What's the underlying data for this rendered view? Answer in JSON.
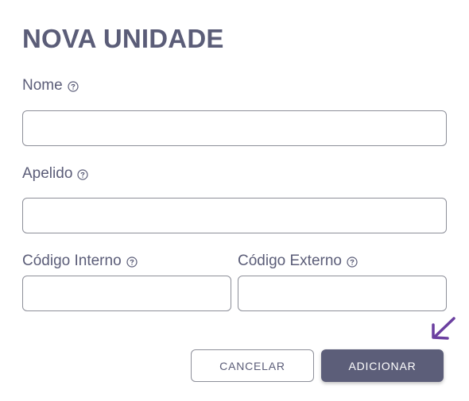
{
  "dialog": {
    "title": "NOVA UNIDADE",
    "fields": {
      "nome": {
        "label": "Nome",
        "value": "",
        "help_icon": "help-circle-icon"
      },
      "apelido": {
        "label": "Apelido",
        "value": "",
        "help_icon": "help-circle-icon"
      },
      "codigo_interno": {
        "label": "Código Interno",
        "value": "",
        "help_icon": "help-circle-icon"
      },
      "codigo_externo": {
        "label": "Código Externo",
        "value": "",
        "help_icon": "help-circle-icon"
      }
    },
    "buttons": {
      "cancel_label": "CANCELAR",
      "add_label": "ADICIONAR"
    },
    "annotation": {
      "icon": "purple-arrow-icon",
      "color": "#6b3fa0"
    },
    "colors": {
      "text": "#5b5d78",
      "primary_button": "#5c5e79",
      "border": "#8d8f99"
    }
  }
}
